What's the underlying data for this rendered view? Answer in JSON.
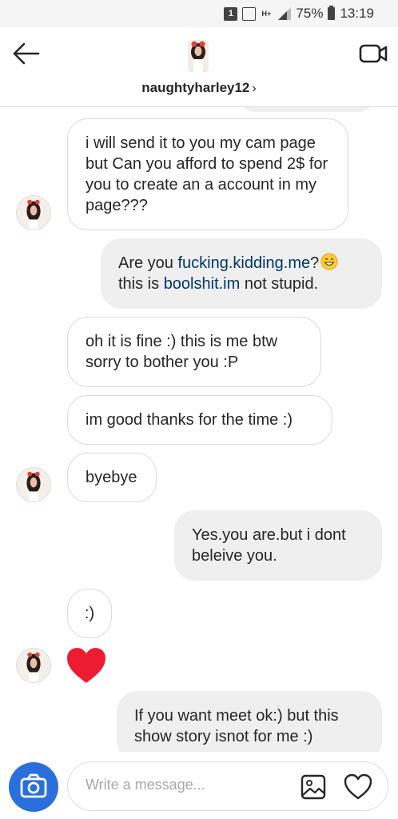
{
  "status_bar": {
    "network": "H+",
    "battery": "75%",
    "time": "13:19",
    "icons": [
      "notification-1-icon",
      "image-icon",
      "network-icon",
      "signal-icon",
      "battery-icon"
    ]
  },
  "header": {
    "username": "naughtyharley12",
    "chevron": "›",
    "icons": [
      "back-arrow-icon",
      "video-call-icon"
    ]
  },
  "messages": [
    {
      "from": "them",
      "text": "i will send it to you my cam page but Can you afford to spend 2$ for you to create an a account in my page???"
    },
    {
      "from": "me",
      "parts": [
        "Are you ",
        "fucking.kidding.me",
        "?",
        " this is ",
        "boolshit.im",
        " not stupid."
      ]
    },
    {
      "from": "them",
      "text": "oh it is fine :) this is me btw sorry to bother you :P"
    },
    {
      "from": "them",
      "text": "im good thanks for the time :)"
    },
    {
      "from": "them",
      "text": "byebye"
    },
    {
      "from": "me",
      "text": "Yes.you are.but i dont beleive you."
    },
    {
      "from": "them",
      "text": ":)"
    },
    {
      "from": "them",
      "type": "heart-reaction"
    },
    {
      "from": "me",
      "text": "If you want meet ok:) but this show story isnot for me :)"
    }
  ],
  "composer": {
    "placeholder": "Write a message...",
    "icons": [
      "camera-icon",
      "gallery-icon",
      "heart-icon"
    ]
  },
  "colors": {
    "link": "#00376b",
    "camera_button": "#2a6fdb",
    "heart": "#ed1c32",
    "outgoing_bubble": "#efefef"
  }
}
